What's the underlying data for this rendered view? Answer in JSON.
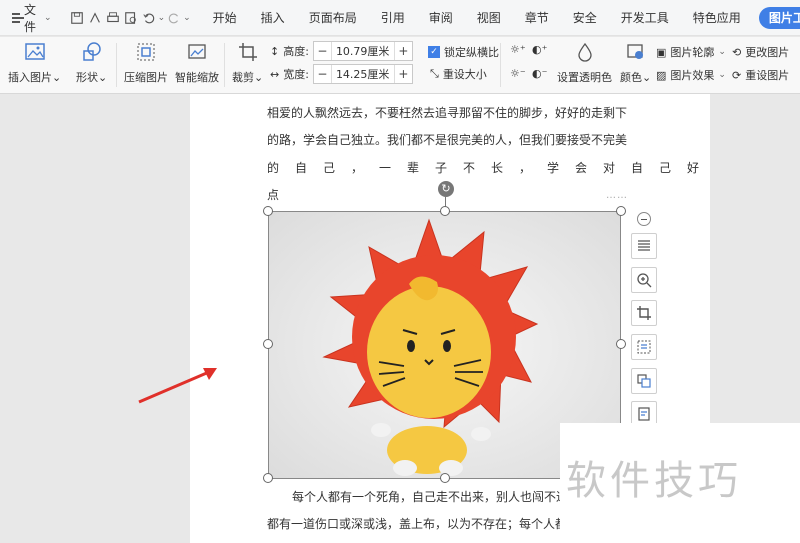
{
  "menu": {
    "file_label": "文件",
    "tabs": [
      "开始",
      "插入",
      "页面布局",
      "引用",
      "审阅",
      "视图",
      "章节",
      "安全",
      "开发工具",
      "特色应用"
    ],
    "active_tab": "图片工具"
  },
  "ribbon": {
    "insert_picture": "插入图片",
    "shape": "形状",
    "compress_picture": "压缩图片",
    "smart_scale": "智能缩放",
    "crop": "裁剪",
    "height_label": "高度:",
    "height_value": "10.79厘米",
    "width_label": "宽度:",
    "width_value": "14.25厘米",
    "lock_ratio": "锁定纵横比",
    "reset_size": "重设大小",
    "set_transparent": "设置透明色",
    "color": "颜色",
    "picture_outline": "图片轮廓",
    "picture_effect": "图片效果",
    "change_picture": "更改图片",
    "reset_picture": "重设图片"
  },
  "document": {
    "lines": [
      "相爱的人飘然远去，不要枉然去追寻那留不住的脚步，好好的走剩下",
      "的路，学会自己独立。我们都不是很完美的人，但我们要接受不完美",
      "的自己，一辈子不长，学会对自己好",
      "点"
    ],
    "after_lines": [
      "每个人都有一个死角，自己走不出来，别人也闯不进去。每个人心里",
      "都有一道伤口或深或浅，盖上布，以为不存在；每个人都"
    ],
    "dots": "……"
  },
  "watermark": "软件技巧",
  "colors": {
    "accent": "#3f7fe6",
    "arrow": "#e0302a",
    "mane": "#e8452c",
    "face": "#f5c842"
  }
}
